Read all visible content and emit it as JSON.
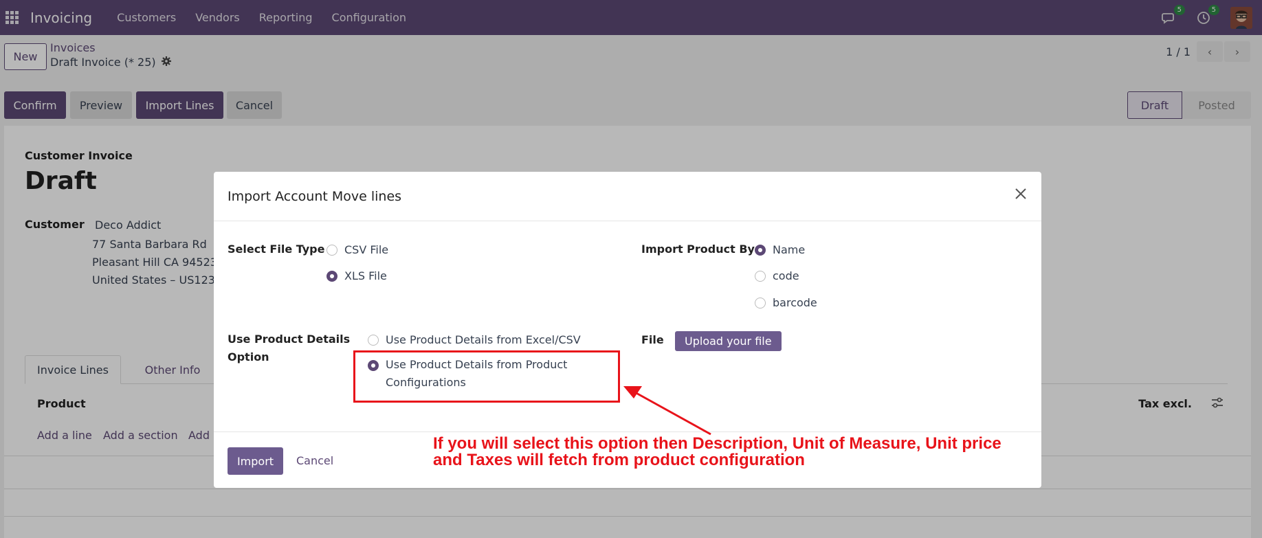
{
  "navbar": {
    "brand": "Invoicing",
    "menu": [
      "Customers",
      "Vendors",
      "Reporting",
      "Configuration"
    ],
    "messages_count": "5",
    "activities_count": "5"
  },
  "control_panel": {
    "new_label": "New",
    "breadcrumb_parent": "Invoices",
    "breadcrumb_current": "Draft Invoice (* 25)",
    "pager": "1 / 1"
  },
  "actions": {
    "confirm": "Confirm",
    "preview": "Preview",
    "import_lines": "Import Lines",
    "cancel": "Cancel"
  },
  "statusbar": {
    "draft": "Draft",
    "posted": "Posted"
  },
  "invoice": {
    "type": "Customer Invoice",
    "state": "Draft",
    "customer_label": "Customer",
    "customer_name": "Deco Addict",
    "address_line1": "77 Santa Barbara Rd",
    "address_line2": "Pleasant Hill CA 94523",
    "address_line3": "United States – US1234",
    "tabs": [
      "Invoice Lines",
      "Other Info"
    ],
    "col_product": "Product",
    "col_tax": "Tax excl.",
    "add_line": "Add a line",
    "add_section": "Add a section",
    "add_note": "Add"
  },
  "modal": {
    "title": "Import Account Move lines",
    "file_type_label": "Select File Type",
    "file_type_options": [
      "CSV File",
      "XLS File"
    ],
    "file_type_selected": "XLS File",
    "import_by_label": "Import Product By",
    "import_by_options": [
      "Name",
      "code",
      "barcode"
    ],
    "import_by_selected": "Name",
    "details_label_line1": "Use Product Details",
    "details_label_line2": "Option",
    "details_option1": "Use Product Details from Excel/CSV",
    "details_option2_line1": "Use Product Details from Product",
    "details_option2_line2": "Configurations",
    "details_selected": "Use Product Details from Product Configurations",
    "file_label": "File",
    "upload_label": "Upload your file",
    "import_button": "Import",
    "cancel_button": "Cancel"
  },
  "annotation": {
    "line1": "If you will select this option then Description, Unit of Measure, Unit price",
    "line2": "and Taxes will fetch from product configuration",
    "color": "#e8131a"
  },
  "colors": {
    "brand": "#5c4875",
    "button_primary": "#6c5b8e"
  }
}
